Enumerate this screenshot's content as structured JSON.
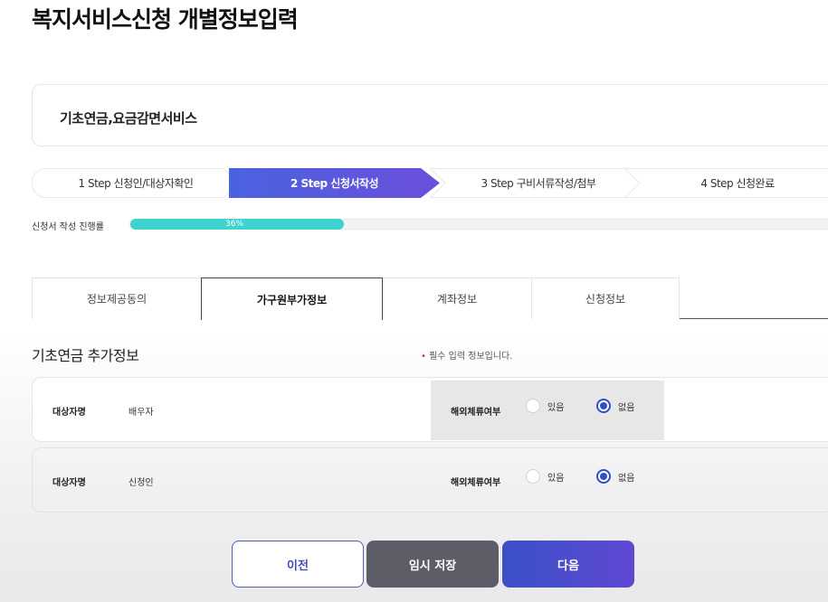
{
  "page": {
    "title": "복지서비스신청 개별정보입력"
  },
  "service": {
    "name": "기초연금,요금감면서비스"
  },
  "steps": [
    {
      "label": "1 Step 신청인/대상자확인",
      "active": false
    },
    {
      "label": "2 Step 신청서작성",
      "active": true
    },
    {
      "label": "3 Step 구비서류작성/첨부",
      "active": false
    },
    {
      "label": "4 Step 신청완료",
      "active": false
    }
  ],
  "progress": {
    "label": "신청서 작성 진행률",
    "value_text": "36%",
    "value": 0.36,
    "color": "#3fd3cf"
  },
  "tabs": [
    {
      "label": "정보제공동의",
      "active": false
    },
    {
      "label": "가구원부가정보",
      "active": true
    },
    {
      "label": "계좌정보",
      "active": false
    },
    {
      "label": "신청정보",
      "active": false
    }
  ],
  "section": {
    "title": "기초연금 추가정보",
    "required_note": "필수 입력 정보입니다."
  },
  "rows": [
    {
      "name_label": "대상자명",
      "name_value": "배우자",
      "field_label": "해외체류여부",
      "options": [
        {
          "label": "있음",
          "checked": false
        },
        {
          "label": "없음",
          "checked": true
        }
      ]
    },
    {
      "name_label": "대상자명",
      "name_value": "신청인",
      "field_label": "해외체류여부",
      "options": [
        {
          "label": "있음",
          "checked": false
        },
        {
          "label": "없음",
          "checked": true
        }
      ]
    }
  ],
  "buttons": {
    "prev": "이전",
    "save": "임시 저장",
    "next": "다음"
  },
  "colors": {
    "accent": "#4a50d4",
    "active_step": "#5b5ce0",
    "primary_button": "#3b50c6",
    "save_button": "#5c5d66"
  }
}
